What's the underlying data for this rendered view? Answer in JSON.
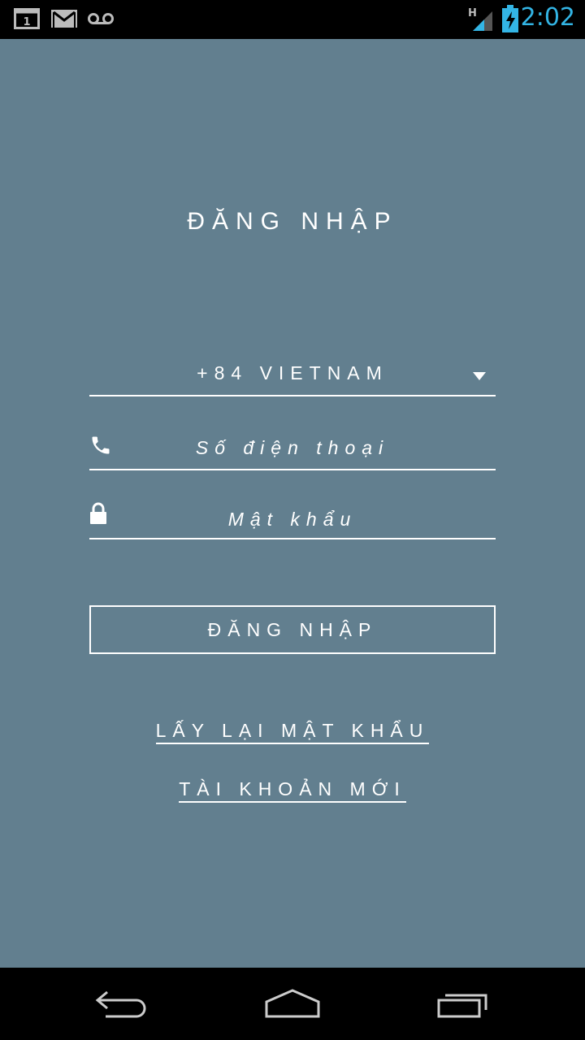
{
  "status_bar": {
    "time": "2:02",
    "icons": [
      "calendar-notification-icon",
      "gmail-icon",
      "voicemail-icon",
      "signal-h-icon",
      "battery-charging-icon"
    ],
    "calendar_day": "1",
    "network_type": "H",
    "accent_color": "#33b5e5"
  },
  "login": {
    "title": "ĐĂNG NHẬP",
    "country_selector": "+84 VIETNAM",
    "phone_placeholder": "Số điện thoại",
    "password_placeholder": "Mật khẩu",
    "login_button": "ĐĂNG NHẬP",
    "forgot_password_link": "LẤY LẠI MẬT KHẨU",
    "register_link": "TÀI KHOẢN MỚI",
    "background_color": "#627f8f"
  },
  "nav_bar": {
    "buttons": [
      "back-icon",
      "home-icon",
      "recent-apps-icon"
    ]
  }
}
